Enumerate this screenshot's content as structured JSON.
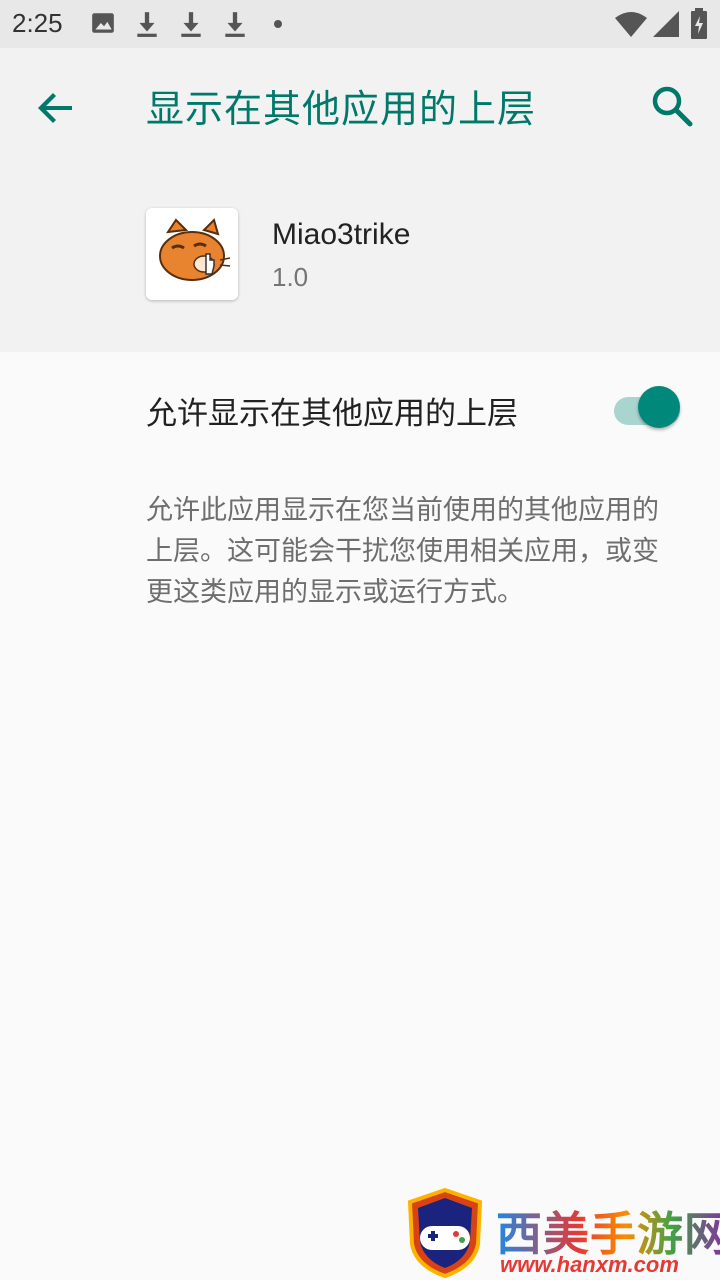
{
  "status_bar": {
    "time": "2:25",
    "left_icons": [
      "image-icon",
      "download-icon",
      "download-icon",
      "download-icon",
      "dot-icon"
    ],
    "right_icons": [
      "wifi-icon",
      "signal-icon",
      "battery-icon"
    ]
  },
  "app_bar": {
    "title": "显示在其他应用的上层",
    "back_icon": "arrow-back-icon",
    "search_icon": "search-icon",
    "accent_color": "#00796b"
  },
  "app_info": {
    "name": "Miao3trike",
    "version": "1.0",
    "icon": "cat-app-icon"
  },
  "setting": {
    "label": "允许显示在其他应用的上层",
    "enabled": true,
    "toggle_color": "#00897b"
  },
  "description": {
    "lines": [
      "允许此应用显示在您当前使用的其他应用的",
      "上层。这可能会干扰您使用相关应用，或变",
      "更这类应用的显示或运行方式。"
    ]
  },
  "watermark": {
    "text": "西美手游网",
    "url": "www.hanxm.com"
  }
}
